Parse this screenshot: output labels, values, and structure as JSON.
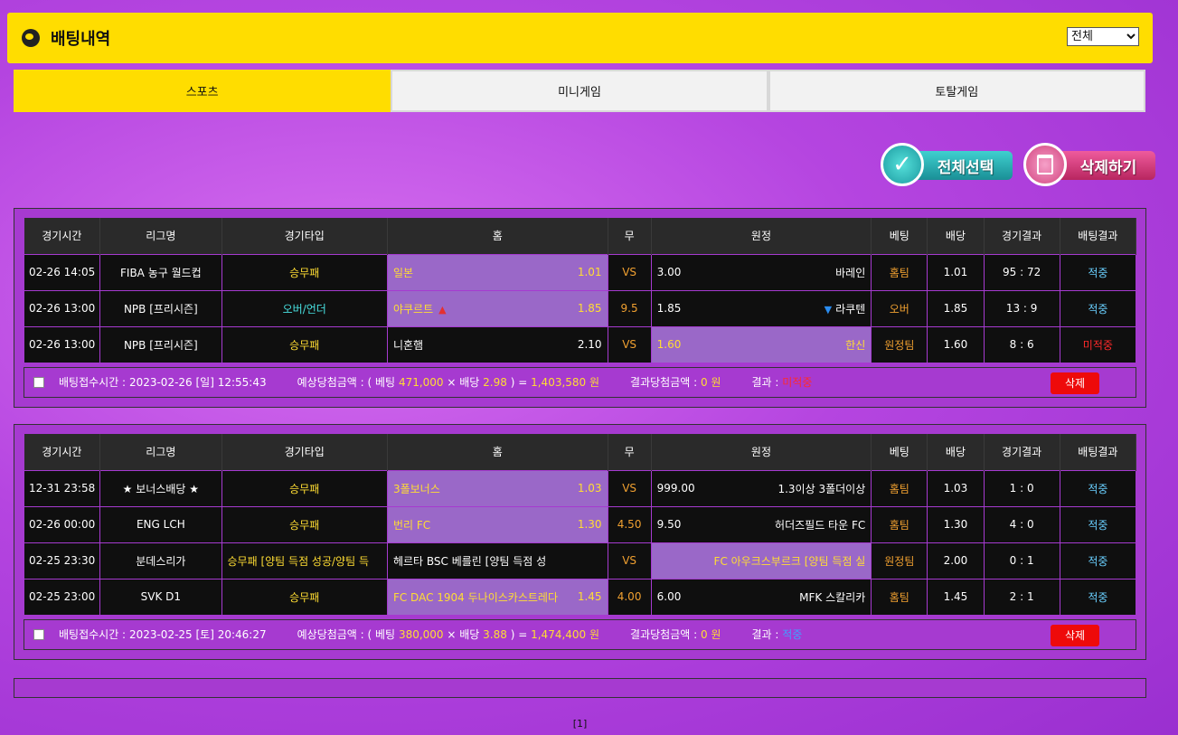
{
  "header": {
    "title": "배팅내역",
    "filter_value": "전체"
  },
  "tabs": [
    "스포츠",
    "미니게임",
    "토탈게임"
  ],
  "actions": {
    "select_all": "전체선택",
    "delete": "삭제하기"
  },
  "columns": [
    "경기시간",
    "리그명",
    "경기타입",
    "홈",
    "무",
    "원정",
    "베팅",
    "배당",
    "경기결과",
    "배팅결과"
  ],
  "bet_slips": [
    {
      "rows": [
        {
          "time": "02-26 14:05",
          "league": "FIBA 농구 월드컵",
          "type": "승무패",
          "home": "일본",
          "home_odds": "1.01",
          "draw": "VS",
          "away_odds": "3.00",
          "away": "바레인",
          "bet": "홈팀",
          "odds": "1.01",
          "score": "95 : 72",
          "status": "적중"
        },
        {
          "time": "02-26 13:00",
          "league": "NPB [프리시즌]",
          "type": "오버/언더",
          "home": "야쿠르트",
          "home_odds": "1.85",
          "draw": "9.5",
          "away_odds": "1.85",
          "away": "라쿠텐",
          "bet": "오버",
          "odds": "1.85",
          "score": "13 : 9",
          "status": "적중"
        },
        {
          "time": "02-26 13:00",
          "league": "NPB [프리시즌]",
          "type": "승무패",
          "home": "니혼햄",
          "home_odds": "2.10",
          "draw": "VS",
          "away_odds": "1.60",
          "away": "한신",
          "bet": "원정팀",
          "odds": "1.60",
          "score": "8 : 6",
          "status": "미적중"
        }
      ],
      "footer": {
        "time_label": "배팅접수시간 :",
        "time": "2023-02-26 [일] 12:55:43",
        "expected_label": "예상당첨금액 : ( 베팅",
        "stake": "471,000",
        "times": "× 배당",
        "total_odds": "2.98",
        "equals": ") =",
        "payout": "1,403,580 원",
        "win_label": "결과당첨금액 :",
        "win_amount": "0 원",
        "result_label": "결과 :",
        "result": "미적중",
        "delete": "삭제"
      }
    },
    {
      "rows": [
        {
          "time": "12-31 23:58",
          "league": "★ 보너스배당 ★",
          "type": "승무패",
          "home": "3폴보너스",
          "home_odds": "1.03",
          "draw": "VS",
          "away_odds": "999.00",
          "away": "1.3이상 3폴더이상",
          "bet": "홈팀",
          "odds": "1.03",
          "score": "1 : 0",
          "status": "적중"
        },
        {
          "time": "02-26 00:00",
          "league": "ENG LCH",
          "type": "승무패",
          "home": "번리 FC",
          "home_odds": "1.30",
          "draw": "4.50",
          "away_odds": "9.50",
          "away": "허더즈필드 타운 FC",
          "bet": "홈팀",
          "odds": "1.30",
          "score": "4 : 0",
          "status": "적중"
        },
        {
          "time": "02-25 23:30",
          "league": "분데스리가",
          "type": "승무패 [양팀 득점 성공/양팀 득",
          "home": "헤르타 BSC 베를린 [양팀 득점 성",
          "home_odds": "",
          "draw": "VS",
          "away_odds": "",
          "away": "FC 아우크스부르크 [양팀 득점 실",
          "bet": "원정팀",
          "odds": "2.00",
          "score": "0 : 1",
          "status": "적중"
        },
        {
          "time": "02-25 23:00",
          "league": "SVK D1",
          "type": "승무패",
          "home": "FC DAC 1904 두나이스카스트레다",
          "home_odds": "1.45",
          "draw": "4.00",
          "away_odds": "6.00",
          "away": "MFK 스칼리카",
          "bet": "홈팀",
          "odds": "1.45",
          "score": "2 : 1",
          "status": "적중"
        }
      ],
      "footer": {
        "time_label": "배팅접수시간 :",
        "time": "2023-02-25 [토] 20:46:27",
        "expected_label": "예상당첨금액 : ( 베팅",
        "stake": "380,000",
        "times": "× 배당",
        "total_odds": "3.88",
        "equals": ") =",
        "payout": "1,474,400 원",
        "win_label": "결과당첨금액 :",
        "win_amount": "0 원",
        "result_label": "결과 :",
        "result": "적중",
        "delete": "삭제"
      }
    }
  ],
  "pager": "[1]"
}
